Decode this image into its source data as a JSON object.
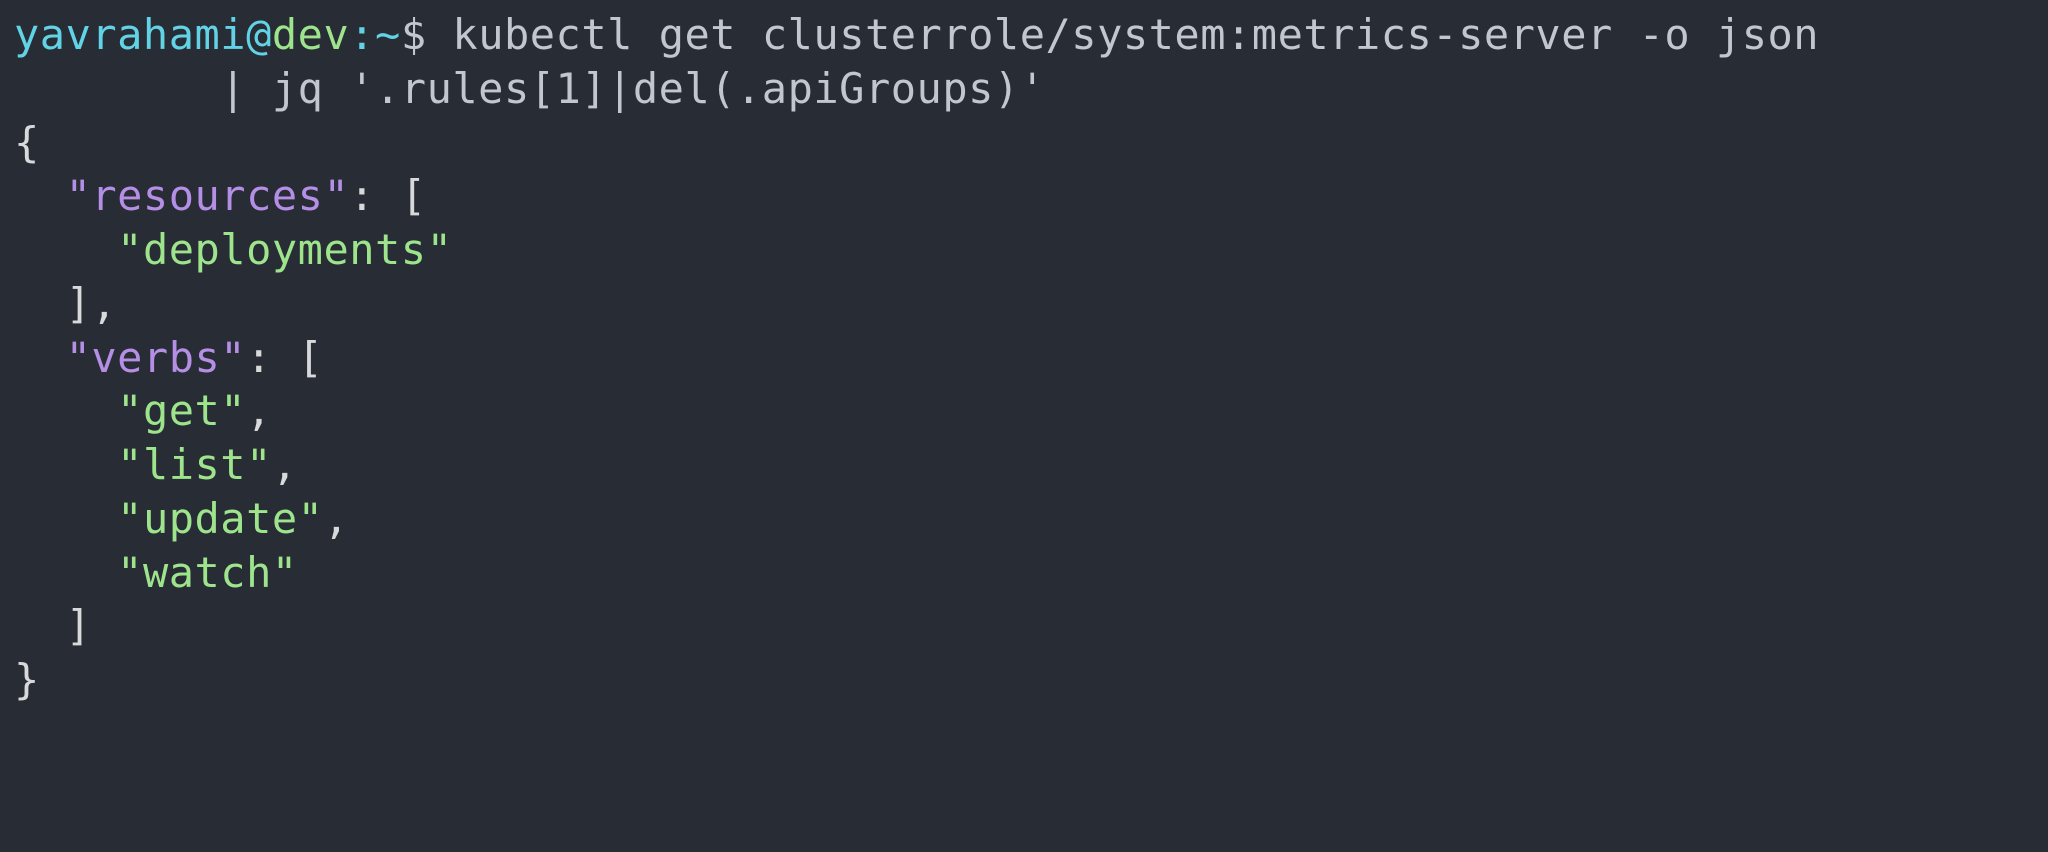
{
  "prompt": {
    "user": "yavrahami",
    "at": "@",
    "host": "dev",
    "sep": ":",
    "path": "~",
    "dollar": "$"
  },
  "command": {
    "line1": " kubectl get clusterrole/system:metrics-server -o json",
    "line2_prefix": "        | ",
    "line2_rest": "jq '.rules[1]|del(.apiGroups)'"
  },
  "json_output": {
    "open_brace": "{",
    "resources_key": "\"resources\"",
    "colon_space": ": ",
    "open_bracket": "[",
    "resources": {
      "0": "\"deployments\""
    },
    "close_bracket": "]",
    "comma": ",",
    "verbs_key": "\"verbs\"",
    "verbs": {
      "0": "\"get\"",
      "1": "\"list\"",
      "2": "\"update\"",
      "3": "\"watch\""
    },
    "close_brace": "}"
  },
  "indent": {
    "i2": "  ",
    "i4": "    "
  }
}
